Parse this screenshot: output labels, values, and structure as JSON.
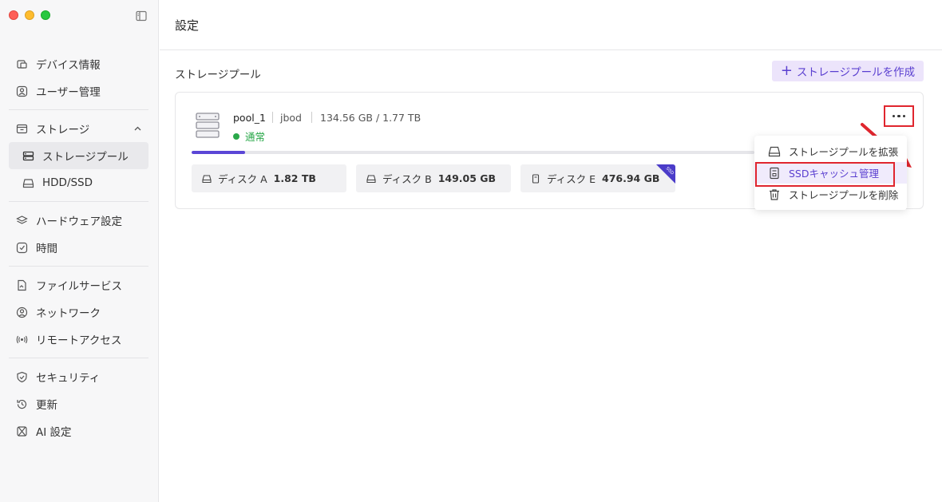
{
  "header": {
    "title": "設定"
  },
  "sidebar": {
    "groups": [
      [
        {
          "label": "デバイス情報",
          "icon": "device-icon"
        },
        {
          "label": "ユーザー管理",
          "icon": "user-icon"
        }
      ],
      [
        {
          "label": "ストレージ",
          "icon": "storage-icon"
        },
        {
          "label": "ストレージプール",
          "icon": "pool-icon"
        },
        {
          "label": "HDD/SSD",
          "icon": "disk-icon"
        }
      ],
      [
        {
          "label": "ハードウェア設定",
          "icon": "hardware-icon"
        },
        {
          "label": "時間",
          "icon": "clock-icon"
        }
      ],
      [
        {
          "label": "ファイルサービス",
          "icon": "file-service-icon"
        },
        {
          "label": "ネットワーク",
          "icon": "network-icon"
        },
        {
          "label": "リモートアクセス",
          "icon": "remote-icon"
        }
      ],
      [
        {
          "label": "セキュリティ",
          "icon": "shield-icon"
        },
        {
          "label": "更新",
          "icon": "update-icon"
        },
        {
          "label": "AI 設定",
          "icon": "ai-icon"
        }
      ]
    ]
  },
  "main": {
    "section_title": "ストレージプール",
    "create_button": "ストレージプールを作成",
    "pool": {
      "name": "pool_1",
      "type": "jbod",
      "size": "134.56 GB / 1.77 TB",
      "status": "通常",
      "usage_fraction": 0.095,
      "disks": [
        {
          "name": "ディスク A",
          "size": "1.82 TB",
          "ssd": false
        },
        {
          "name": "ディスク B",
          "size": "149.05 GB",
          "ssd": false
        },
        {
          "name": "ディスク E",
          "size": "476.94 GB",
          "ssd": true
        }
      ],
      "ssd_badge": "SSD"
    },
    "menu": {
      "items": [
        {
          "label": "ストレージプールを拡張",
          "icon": "disk-icon"
        },
        {
          "label": "SSDキャッシュ管理",
          "icon": "ssd-icon"
        },
        {
          "label": "ストレージプールを削除",
          "icon": "trash-icon"
        }
      ]
    }
  },
  "colors": {
    "accent": "#5b46d6",
    "status_ok": "#2aa84a",
    "highlight_red": "#e0262e"
  }
}
